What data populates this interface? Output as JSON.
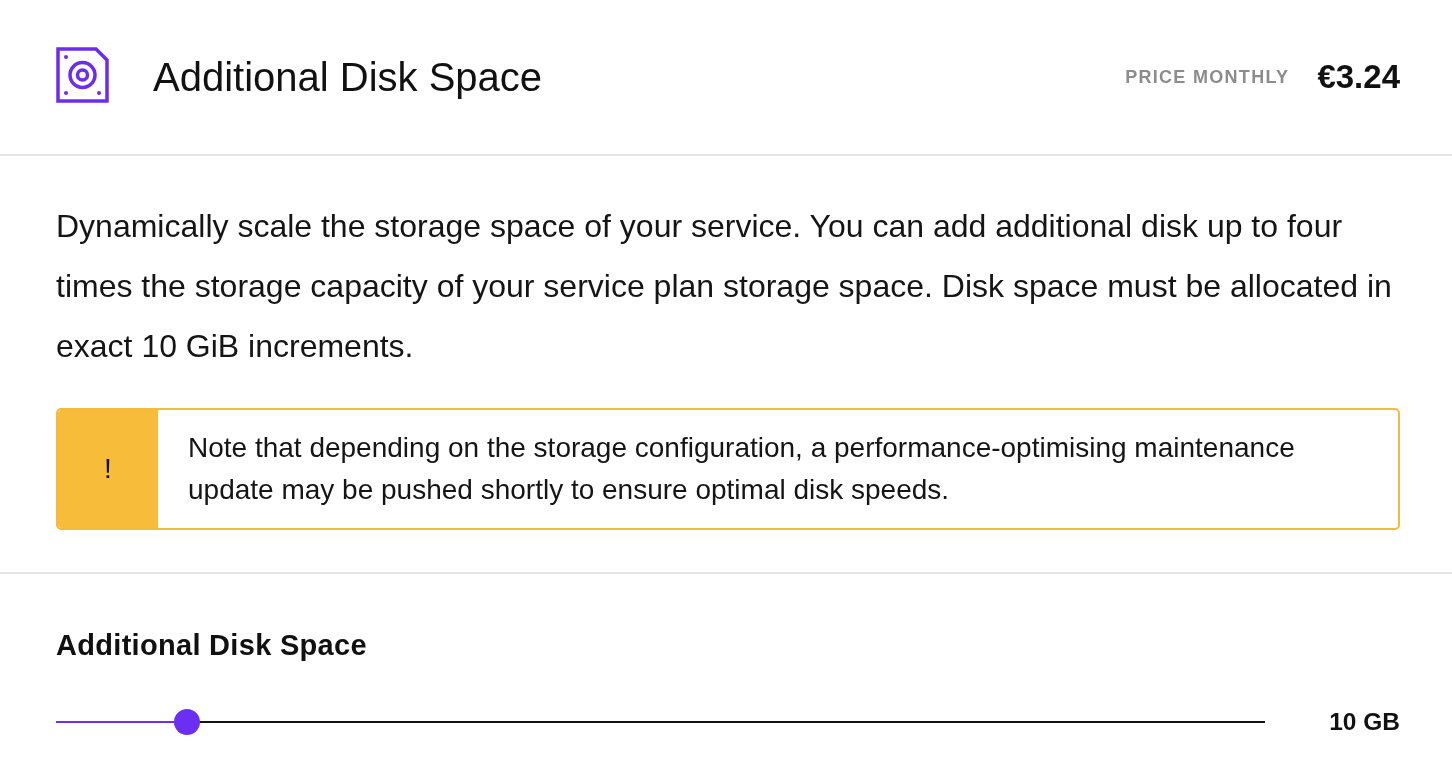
{
  "header": {
    "title": "Additional Disk Space",
    "price_label": "PRICE MONTHLY",
    "price": "€3.24"
  },
  "description": "Dynamically scale the storage space of your service. You can add additional disk up to four times the storage capacity of your service plan storage space. Disk space must be allocated in exact 10 GiB increments.",
  "notice": {
    "icon": "!",
    "text": "Note that depending on the storage configuration, a performance-optimising maintenance update may be pushed shortly to ensure optimal disk speeds."
  },
  "disk_space": {
    "label": "Additional Disk Space",
    "slider": {
      "level": 0.108
    },
    "value": "10 GB"
  }
}
